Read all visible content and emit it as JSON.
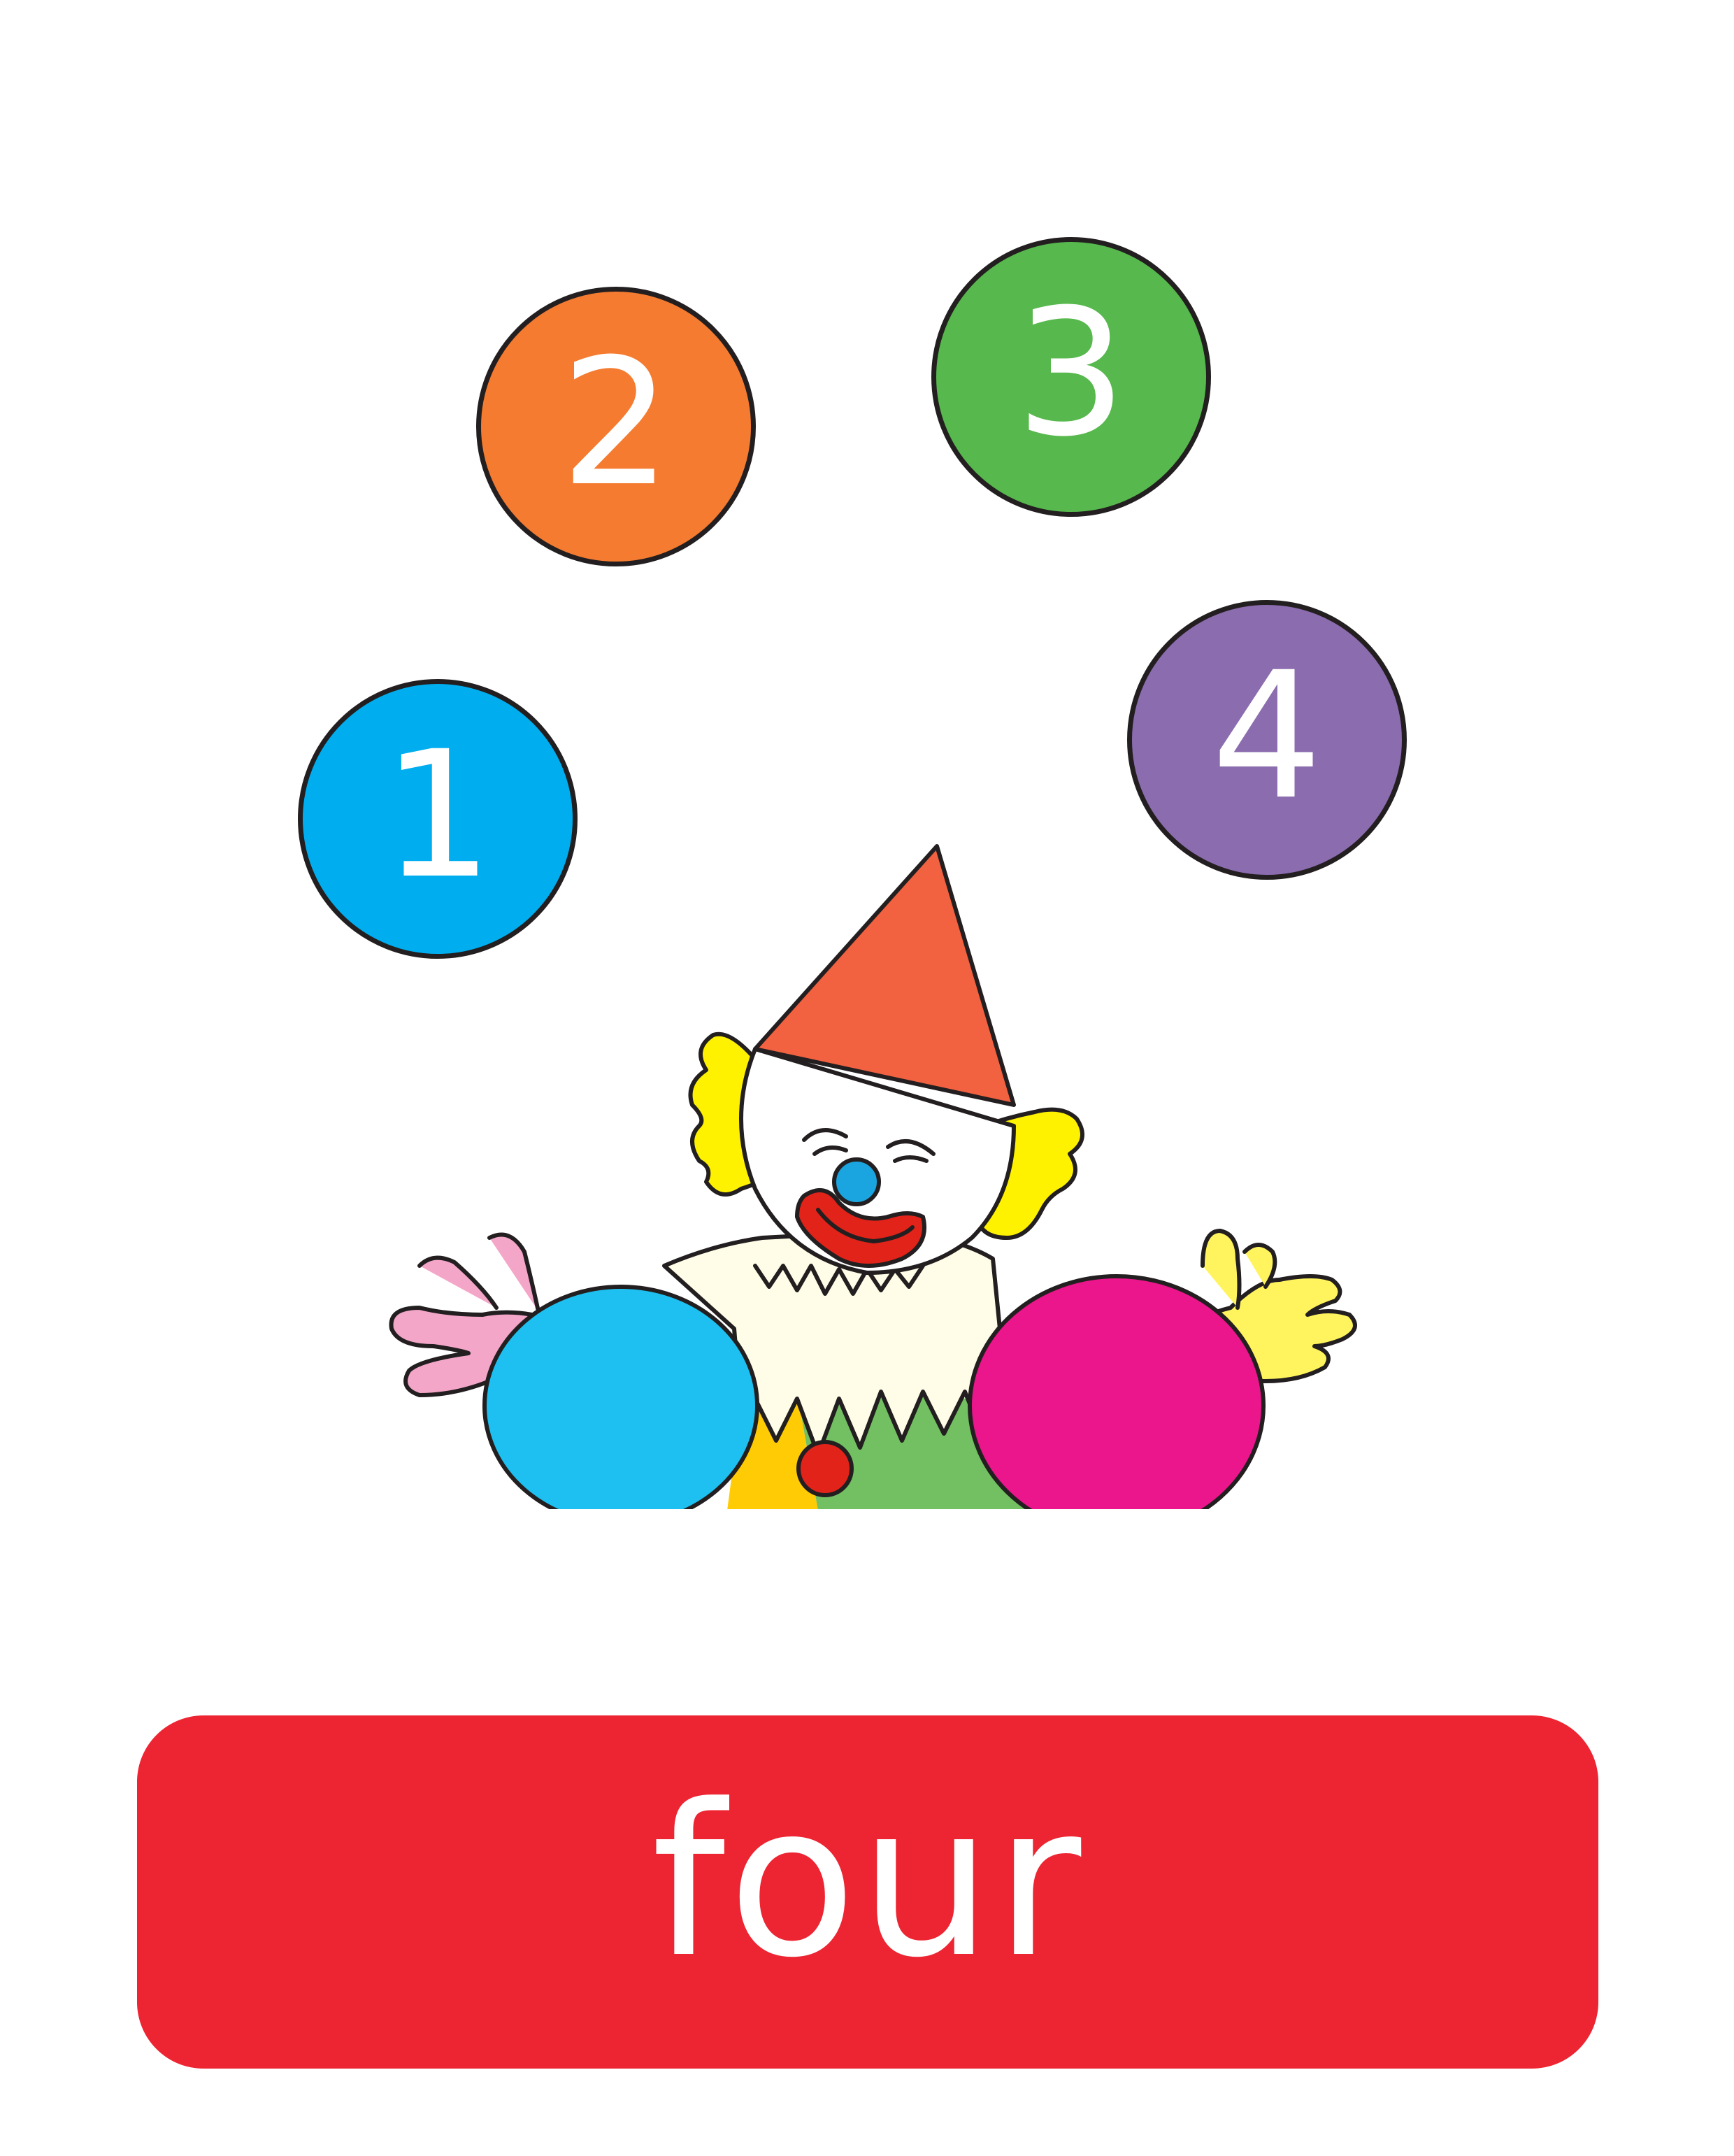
{
  "balls": [
    {
      "number": "1",
      "color": "#00aeef"
    },
    {
      "number": "2",
      "color": "#f47b30"
    },
    {
      "number": "3",
      "color": "#57b84d"
    },
    {
      "number": "4",
      "color": "#8b6cae"
    }
  ],
  "word": "four",
  "colors": {
    "label_background": "#ed2431",
    "outline": "#231f20",
    "hat": "#f26140",
    "hair": "#fff200",
    "nose": "#1ba5e0",
    "mouth": "#e2231a",
    "left_arm": "#1dc0f0",
    "right_arm": "#eb158c",
    "left_hand": "#f4a6c9",
    "right_hand": "#fff45d",
    "collar": "#fffde7",
    "body_yellow": "#ffcb05",
    "body_green": "#72c062",
    "button": "#e2231a"
  },
  "icons": [
    "number-ball-icon",
    "clown-icon"
  ]
}
